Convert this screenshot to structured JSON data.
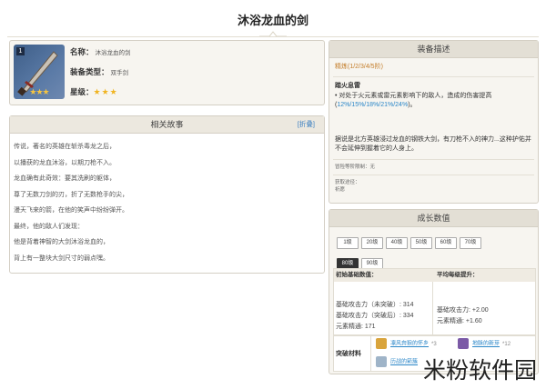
{
  "page_title": "沐浴龙血的剑",
  "card": {
    "rank": "1",
    "name_label": "名称：",
    "name_value": "沐浴龙血的剑",
    "type_label": "装备类型：",
    "type_value": "双手剑",
    "rarity_label": "星级：",
    "rarity_stars": "★★★",
    "image_stars": "★★★"
  },
  "story": {
    "title": "相关故事",
    "link": "[折叠]",
    "lines": [
      "传说，著名的英雄在斩杀毒龙之后，",
      "以播获的龙血沐浴，以期刀枪不入。",
      "龙血确有此奇效：要其洗刷的躯体，",
      "尊了无数刀剑的刃，折了无数枪手的尖，",
      "漫天飞来的箭，在他的笑声中纷纷弹开。",
      "最终，他的敌人们发现：",
      "他是背着神智的大剑沐浴龙血的，",
      "背上有一整块大剑尺寸的弱点嘿。"
    ]
  },
  "desc": {
    "title": "装备描述",
    "refine": "精炼(1/2/3/4/5阶)",
    "skill_name": "踏火息雷",
    "skill_text_prefix": "• 对处于火元素或雷元素影响下的敌人，造成的伤害提高(",
    "skill_values": "12%/15%/18%/21%/24%",
    "skill_text_suffix": ")。",
    "lore": "据说是北方英雄浸过龙血的钢铁大剑，有刀枪不入的神力...这种护佑并不会延伸到握着它的人身上。",
    "meta1": "冒险等阶限制：无",
    "meta2_label": "获取途径：",
    "meta2_value": "祈愿"
  },
  "growth": {
    "title": "成长数值",
    "levels": [
      "1级",
      "20级",
      "40级",
      "50级",
      "60级",
      "70级",
      "80级",
      "90级"
    ],
    "active_level": "80级",
    "col1_head": "初始基础数值：",
    "col2_head": "平均每级提升：",
    "col1_lines": [
      "基础攻击力（未突破）: 314",
      "基础攻击力（突破后）: 334",
      "元素精通: 171"
    ],
    "col2_lines": [
      "基础攻击力: +2.00",
      "元素精通: +1.60"
    ],
    "materials_label": "突破材料",
    "materials": [
      {
        "name": "凛风奔狼的怀乡",
        "count": "*3",
        "color": "#d9a43c"
      },
      {
        "name": "地脉的新芽",
        "count": "*12",
        "color": "#7b5aa6"
      },
      {
        "name": "历战的箭簇",
        "count": "",
        "color": "#9fb4c8"
      }
    ]
  },
  "watermark": "米粉软件园"
}
